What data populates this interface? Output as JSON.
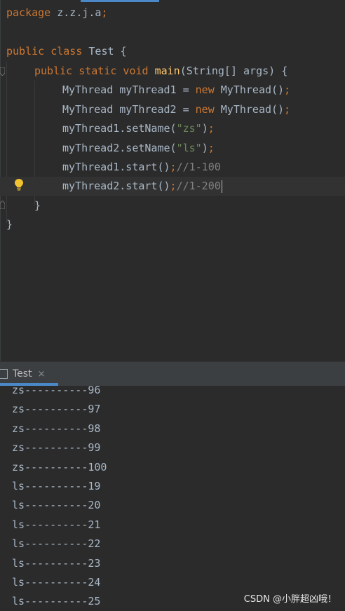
{
  "editor": {
    "package_kw": "package",
    "package_name": " z.z.j.a",
    "semicolon": ";",
    "public_kw": "public",
    "class_kw": " class",
    "class_name": " Test {",
    "static_kw": " static",
    "void_kw": " void",
    "main_name": " main",
    "main_params": "(String[] args) {",
    "l1_type": "MyThread myThread1 = ",
    "l2_type": "MyThread myThread2 = ",
    "new_kw": "new",
    "ctor": " MyThread()",
    "l3_call": "myThread1.setName(",
    "l3_str": "\"zs\"",
    "l4_call": "myThread2.setName(",
    "l4_str": "\"ls\"",
    "close_paren": ")",
    "l5_call": "myThread1.start()",
    "l5_comment": "//1-100",
    "l6_call": "myThread2.start()",
    "l6_comment": "//1-200",
    "close_brace": "}"
  },
  "run": {
    "tab_label": "Test",
    "close_glyph": "×",
    "output": [
      "zs----------96",
      "zs----------97",
      "zs----------98",
      "zs----------99",
      "zs----------100",
      "ls----------19",
      "ls----------20",
      "ls----------21",
      "ls----------22",
      "ls----------23",
      "ls----------24",
      "ls----------25"
    ]
  },
  "watermark": "CSDN @小胖超凶哦！",
  "icons": {
    "intention": "lightbulb-icon",
    "fold": "fold-marker-icon",
    "run_tab": "run-config-icon"
  },
  "colors": {
    "background": "#2b2b2b",
    "keyword": "#cc7832",
    "method": "#ffc66d",
    "string": "#6a8759",
    "comment": "#808080",
    "text": "#a9b7c6",
    "accent": "#4a88c7"
  }
}
